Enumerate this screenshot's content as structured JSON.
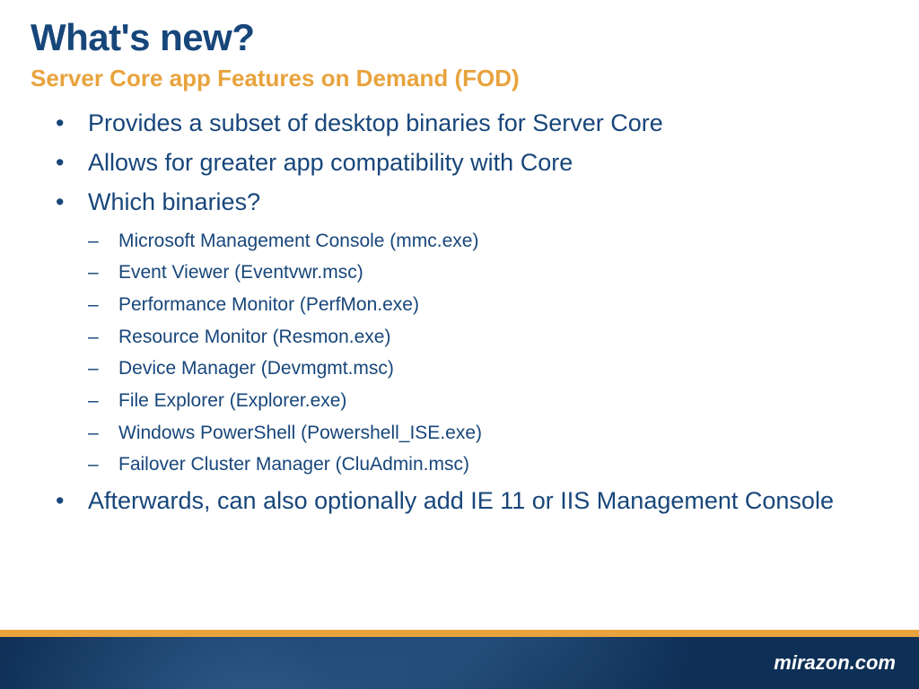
{
  "title": "What's new?",
  "subtitle": "Server Core app Features on Demand (FOD)",
  "bullets": [
    {
      "text": "Provides a subset of desktop binaries for Server Core"
    },
    {
      "text": "Allows for greater app compatibility with Core"
    },
    {
      "text": "Which binaries?",
      "sub": [
        "Microsoft Management Console (mmc.exe)",
        "Event Viewer (Eventvwr.msc)",
        "Performance Monitor (PerfMon.exe)",
        "Resource Monitor (Resmon.exe)",
        "Device Manager (Devmgmt.msc)",
        "File Explorer (Explorer.exe)",
        "Windows PowerShell (Powershell_ISE.exe)",
        "Failover Cluster Manager (CluAdmin.msc)"
      ]
    },
    {
      "text": "Afterwards, can also optionally add IE 11 or IIS Management Console"
    }
  ],
  "footer": {
    "brand": "mirazon.com"
  }
}
